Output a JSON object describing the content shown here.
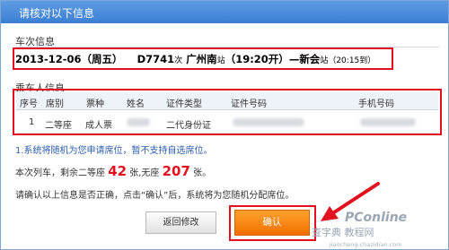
{
  "dialog": {
    "title": "请核对以下信息"
  },
  "train": {
    "section_label": "车次信息",
    "date": "2013-12-06（周五）",
    "train_no": "D7741",
    "train_suffix": "次",
    "from_station": "广州南",
    "station_suffix_1": "站",
    "depart": "（19:20开）",
    "dash": "—",
    "to_station": "新会",
    "station_suffix_2": "站",
    "arrive": "（20:15到）"
  },
  "passengers": {
    "section_label": "乘车人信息",
    "columns": [
      "序号",
      "席别",
      "票种",
      "姓名",
      "证件类型",
      "证件号码",
      "手机号码"
    ],
    "rows": [
      {
        "index": "1",
        "seat": "二等座",
        "ticket_type": "成人票",
        "name": "",
        "id_type": "二代身份证",
        "id_no": "",
        "phone": ""
      }
    ]
  },
  "notices": {
    "line1": "1.系统将随机为您申请席位，暂不支持自选席位。",
    "line2_prefix": "本次列车，剩余二等座",
    "second_class_left": "42",
    "line2_mid": "张,无座",
    "no_seat_left": "207",
    "line2_suffix": "张。",
    "line3": "请确认以上信息是否正确，点击“确认”后，系统将为您随机分配席位。"
  },
  "buttons": {
    "back": "返回修改",
    "confirm": "确认"
  },
  "watermark": {
    "brand": "PConline",
    "site": "查字典 教程网",
    "url": "jiaocheng.chazidian.com"
  },
  "colors": {
    "title_bar": "#3b7fd3",
    "highlight_red": "#e3101f",
    "confirm_orange": "#f27000",
    "notice_blue": "#2a5db0"
  }
}
